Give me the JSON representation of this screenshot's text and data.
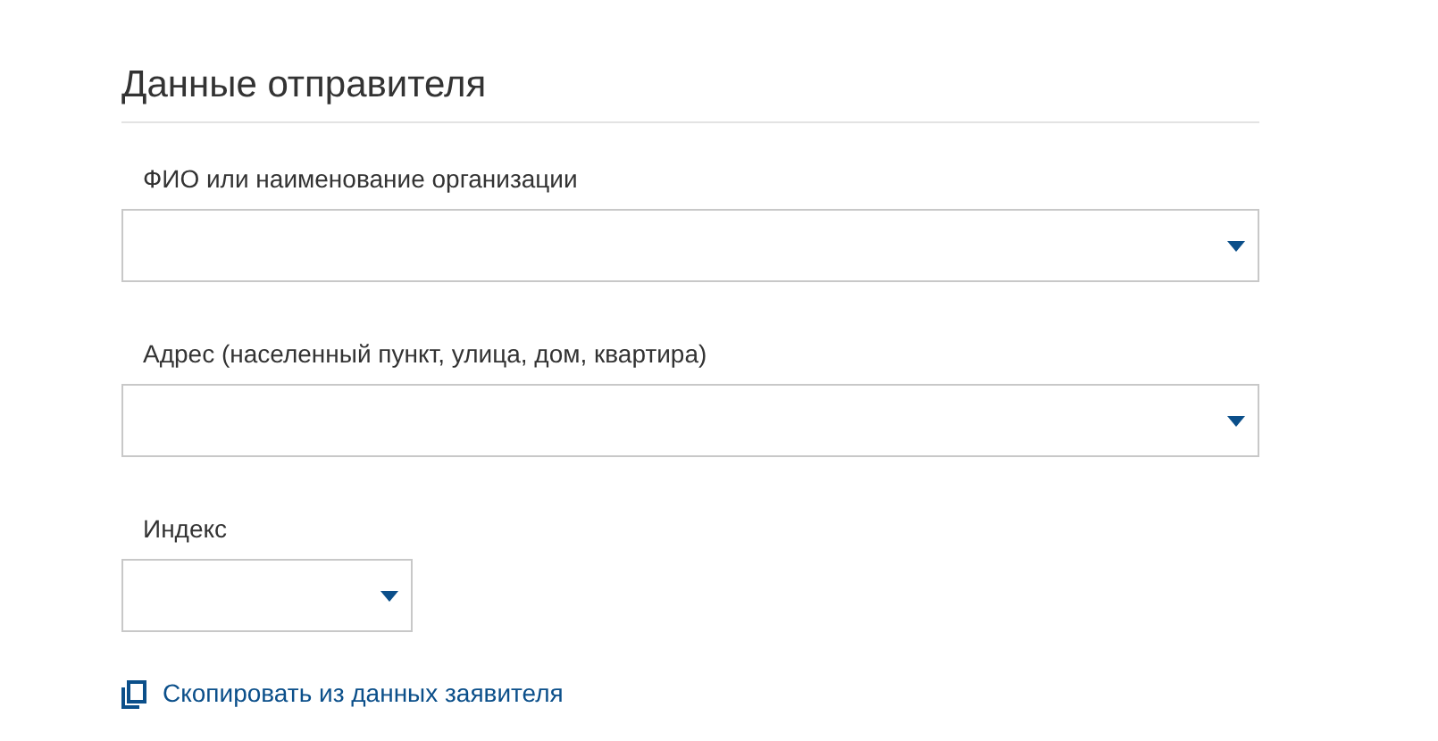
{
  "section": {
    "title": "Данные отправителя"
  },
  "fields": [
    {
      "label": "ФИО или наименование организации",
      "kind": "wide"
    },
    {
      "label": "Адрес (населенный пункт, улица, дом, квартира)",
      "kind": "wide"
    },
    {
      "label": "Индекс",
      "kind": "narrow"
    }
  ],
  "copy_link": {
    "label": "Скопировать из данных заявителя"
  }
}
